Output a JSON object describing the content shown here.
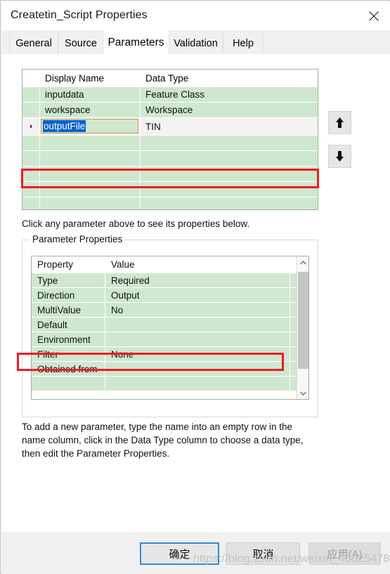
{
  "window": {
    "title": "Createtin_Script Properties",
    "close_icon": "close-icon"
  },
  "tabs": [
    {
      "label": "General",
      "active": false
    },
    {
      "label": "Source",
      "active": false
    },
    {
      "label": "Parameters",
      "active": true
    },
    {
      "label": "Validation",
      "active": false
    },
    {
      "label": "Help",
      "active": false
    }
  ],
  "parameters_grid": {
    "columns": [
      "Display Name",
      "Data Type"
    ],
    "rows": [
      {
        "name": "inputdata",
        "type": "Feature Class",
        "editing": false
      },
      {
        "name": "workspace",
        "type": "Workspace",
        "editing": false
      },
      {
        "name": "outputFile",
        "type": "TIN",
        "editing": true,
        "marker": "◖"
      },
      {
        "name": "",
        "type": "",
        "editing": false
      },
      {
        "name": "",
        "type": "",
        "editing": false
      },
      {
        "name": "",
        "type": "",
        "editing": false
      },
      {
        "name": "",
        "type": "",
        "editing": false
      },
      {
        "name": "",
        "type": "",
        "editing": false
      }
    ]
  },
  "reorder": {
    "move_up_icon": "arrow-up-icon",
    "move_down_icon": "arrow-down-icon"
  },
  "hint_text": "Click any parameter above to see its properties below.",
  "parameter_properties": {
    "legend": "Parameter Properties",
    "columns": [
      "Property",
      "Value"
    ],
    "rows": [
      {
        "property": "Type",
        "value": "Required"
      },
      {
        "property": "Direction",
        "value": "Output"
      },
      {
        "property": "MultiValue",
        "value": "No"
      },
      {
        "property": "Default",
        "value": ""
      },
      {
        "property": "Environment",
        "value": ""
      },
      {
        "property": "Filter",
        "value": "None"
      },
      {
        "property": "Obtained from",
        "value": ""
      }
    ],
    "scrollbar": {
      "up_icon": "chevron-up-icon",
      "down_icon": "chevron-down-icon"
    }
  },
  "description": "To add a new parameter, type the name into an empty row in the name column, click in the Data Type column to choose a data type, then edit the Parameter Properties.",
  "footer": {
    "ok_label": "确定",
    "cancel_label": "取消",
    "apply_label": "应用(A)"
  },
  "watermark": "https://blog.csdn.net/weixin_40625478",
  "colors": {
    "annotation_red": "#ee1c24",
    "grid_row_green": "#cfe7cf",
    "selection_blue": "#0a64c8",
    "default_button_border": "#3a87d9"
  }
}
